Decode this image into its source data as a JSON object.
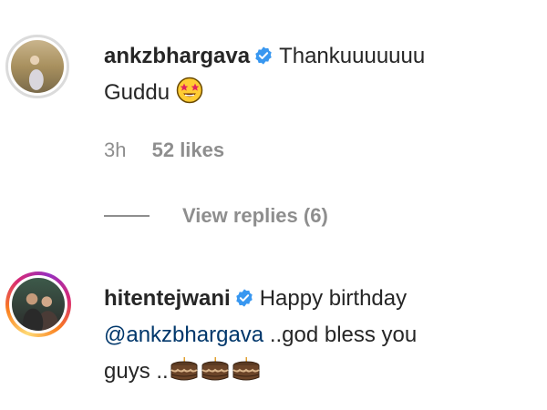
{
  "comments": [
    {
      "username": "ankzbhargava",
      "verified": true,
      "text_line1": "Thankuuuuuuu",
      "text_line2": "Guddu",
      "emoji": "star-struck-emoji",
      "time": "3h",
      "likes": "52 likes",
      "view_replies": "View replies (6)"
    },
    {
      "username": "hitentejwani",
      "verified": true,
      "text_line1": "Happy birthday",
      "mention": "@ankzbhargava",
      "text_line2_rest": "..god bless you",
      "text_line3": "guys ..",
      "emoji": "birthday-cake-emoji"
    }
  ],
  "colors": {
    "verified_blue": "#3897f0",
    "mention": "#00376b",
    "meta_gray": "#8e8e8e",
    "text": "#262626"
  }
}
